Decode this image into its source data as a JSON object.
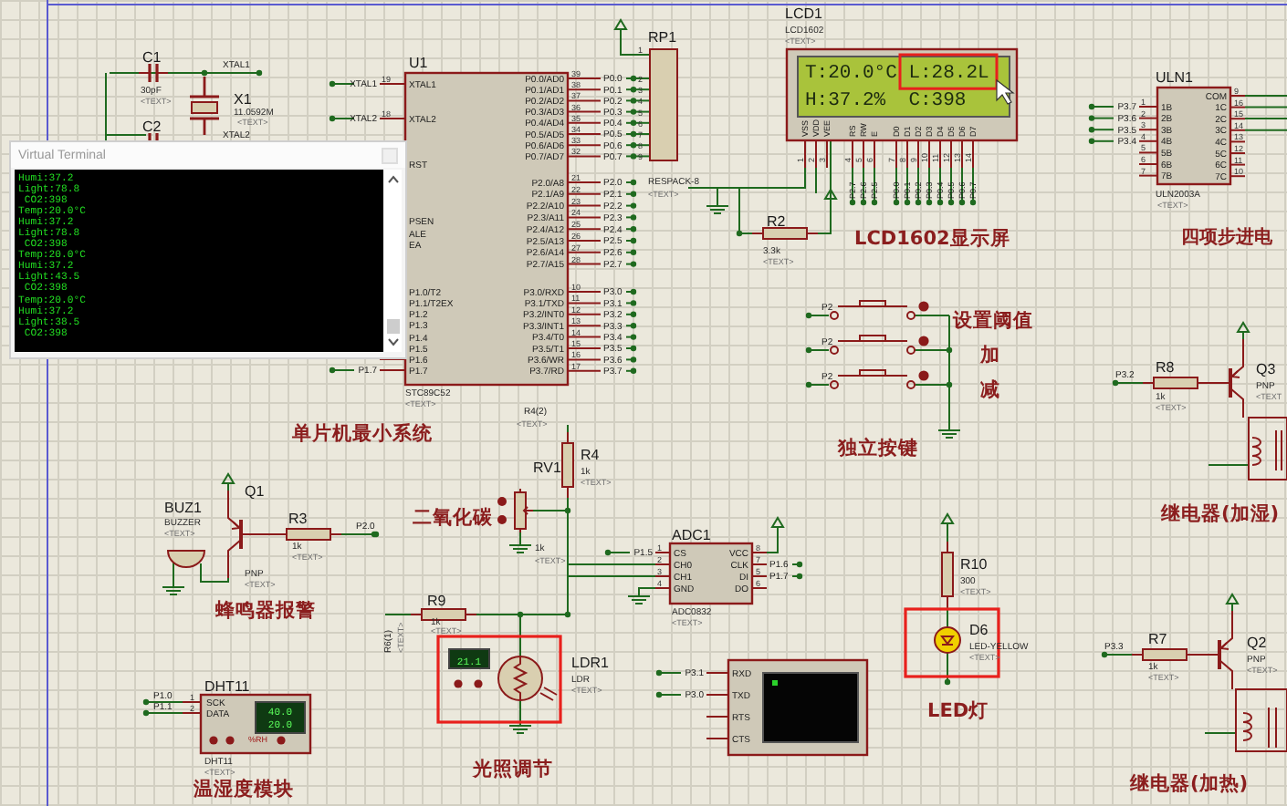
{
  "terminal_window": {
    "title": "Virtual Terminal",
    "lines": [
      "Humi:37.2",
      "Light:78.8",
      " CO2:398",
      "Temp:20.0°C",
      "Humi:37.2",
      "Light:78.8",
      " CO2:398",
      "Temp:20.0°C",
      "Humi:37.2",
      "Light:43.5",
      " CO2:398",
      "Temp:20.0°C",
      "Humi:37.2",
      "Light:38.5",
      " CO2:398"
    ]
  },
  "section_titles": [
    "单片机最小系统",
    "LCD1602显示屏",
    "四项步进电",
    "设置阈值",
    "加",
    "减",
    "独立按键",
    "二氧化碳",
    "蜂鸣器报警",
    "继电器(加湿)",
    "LED灯",
    "光照调节",
    "温湿度模块",
    "继电器(加热)"
  ],
  "components": [
    {
      "kind": "capacitor",
      "ref": "C1",
      "value": "30pF",
      "tag": "<TEXT>"
    },
    {
      "kind": "capacitor",
      "ref": "C2"
    },
    {
      "kind": "crystal",
      "ref": "X1",
      "value": "11.0592M",
      "tag": "<TEXT>"
    },
    {
      "kind": "respack",
      "ref": "RP1",
      "value": "RESPACK-8",
      "tag": "<TEXT>",
      "pins": [
        "1",
        "2",
        "3",
        "4",
        "5",
        "6",
        "7",
        "8",
        "9"
      ]
    },
    {
      "kind": "resistor",
      "ref": "R2",
      "value": "3.3k",
      "tag": "<TEXT>"
    },
    {
      "kind": "resistor",
      "ref": "R8",
      "value": "1k",
      "tag": "<TEXT>"
    },
    {
      "kind": "transistor",
      "ref": "Q3",
      "value": "PNP",
      "tag": "<TEXT"
    },
    {
      "kind": "resistor",
      "ref": "R4",
      "value": "1k",
      "tag": "<TEXT>"
    },
    {
      "kind": "potentiometer",
      "ref": "RV1",
      "value": "1k",
      "tag": "<TEXT>"
    },
    {
      "kind": "buzzer",
      "ref": "BUZ1",
      "value": "BUZZER",
      "tag": "<TEXT>"
    },
    {
      "kind": "transistor",
      "ref": "Q1",
      "value": "PNP",
      "tag": "<TEXT>"
    },
    {
      "kind": "resistor",
      "ref": "R3",
      "value": "1k",
      "tag": "<TEXT>"
    },
    {
      "kind": "resistor",
      "ref": "R9",
      "value": "1k",
      "tag": "<TEXT>"
    },
    {
      "kind": "ldr",
      "ref": "LDR1",
      "value": "LDR",
      "tag": "<TEXT>"
    },
    {
      "kind": "resistor",
      "ref": "R10",
      "value": "300",
      "tag": "<TEXT>"
    },
    {
      "kind": "led",
      "ref": "D6",
      "value": "LED-YELLOW",
      "tag": "<TEXT>"
    },
    {
      "kind": "resistor",
      "ref": "R7",
      "value": "1k",
      "tag": "<TEXT>"
    },
    {
      "kind": "transistor",
      "ref": "Q2",
      "value": "PNP",
      "tag": "<TEXT>"
    }
  ],
  "net_labels": [
    {
      "text": "XTAL1"
    },
    {
      "text": "XTAL2"
    },
    {
      "text": "R4(2)",
      "tag": "<TEXT>"
    },
    {
      "text": "R6(1)",
      "tag": "<TEXT>"
    },
    {
      "text": "P2.0"
    },
    {
      "text": "P3.2"
    },
    {
      "text": "P3.3"
    },
    {
      "text": "P2"
    },
    {
      "text": "P2"
    },
    {
      "text": "P2"
    }
  ],
  "chips": [
    {
      "kind": "ic",
      "ref": "U1",
      "part": "STC89C52",
      "tag": "<TEXT>",
      "left": [
        {
          "name": "XTAL1",
          "num": "19",
          "net": "XTAL1"
        },
        {
          "name": "XTAL2",
          "num": "18",
          "net": "XTAL2"
        },
        {
          "name": "RST"
        },
        {
          "name": "PSEN"
        },
        {
          "name": "ALE"
        },
        {
          "name": "EA"
        },
        {
          "name": "P1.0/T2"
        },
        {
          "name": "P1.1/T2EX"
        },
        {
          "name": "P1.2"
        },
        {
          "name": "P1.3"
        },
        {
          "name": "P1.4"
        },
        {
          "name": "P1.5"
        },
        {
          "name": "P1.6"
        },
        {
          "name": "P1.7",
          "net": "P1.7"
        }
      ],
      "right": [
        {
          "name": "P0.0/AD0",
          "num": "39",
          "net": "P0.0"
        },
        {
          "name": "P0.1/AD1",
          "num": "38",
          "net": "P0.1"
        },
        {
          "name": "P0.2/AD2",
          "num": "37",
          "net": "P0.2"
        },
        {
          "name": "P0.3/AD3",
          "num": "36",
          "net": "P0.3"
        },
        {
          "name": "P0.4/AD4",
          "num": "35",
          "net": "P0.4"
        },
        {
          "name": "P0.5/AD5",
          "num": "34",
          "net": "P0.5"
        },
        {
          "name": "P0.6/AD6",
          "num": "33",
          "net": "P0.6"
        },
        {
          "name": "P0.7/AD7",
          "num": "32",
          "net": "P0.7"
        },
        {
          "name": "P2.0/A8",
          "num": "21",
          "net": "P2.0"
        },
        {
          "name": "P2.1/A9",
          "num": "22",
          "net": "P2.1"
        },
        {
          "name": "P2.2/A10",
          "num": "23",
          "net": "P2.2"
        },
        {
          "name": "P2.3/A11",
          "num": "24",
          "net": "P2.3"
        },
        {
          "name": "P2.4/A12",
          "num": "25",
          "net": "P2.4"
        },
        {
          "name": "P2.5/A13",
          "num": "26",
          "net": "P2.5"
        },
        {
          "name": "P2.6/A14",
          "num": "27",
          "net": "P2.6"
        },
        {
          "name": "P2.7/A15",
          "num": "28",
          "net": "P2.7"
        },
        {
          "name": "P3.0/RXD",
          "num": "10",
          "net": "P3.0"
        },
        {
          "name": "P3.1/TXD",
          "num": "11",
          "net": "P3.1"
        },
        {
          "name": "P3.2/INT0",
          "num": "12",
          "net": "P3.2"
        },
        {
          "name": "P3.3/INT1",
          "num": "13",
          "net": "P3.3"
        },
        {
          "name": "P3.4/T0",
          "num": "14",
          "net": "P3.4"
        },
        {
          "name": "P3.5/T1",
          "num": "15",
          "net": "P3.5"
        },
        {
          "name": "P3.6/WR",
          "num": "16",
          "net": "P3.6"
        },
        {
          "name": "P3.7/RD",
          "num": "17",
          "net": "P3.7"
        }
      ]
    },
    {
      "kind": "ic",
      "ref": "ULN1",
      "part": "ULN2003A",
      "tag": "<TEXT>",
      "left": [
        {
          "name": "1B",
          "num": "1",
          "net": "P3.7"
        },
        {
          "name": "2B",
          "num": "2",
          "net": "P3.6"
        },
        {
          "name": "3B",
          "num": "3",
          "net": "P3.5"
        },
        {
          "name": "4B",
          "num": "4",
          "net": "P3.4"
        },
        {
          "name": "5B",
          "num": "5"
        },
        {
          "name": "6B",
          "num": "6"
        },
        {
          "name": "7B",
          "num": "7"
        }
      ],
      "right": [
        {
          "name": "COM",
          "num": "9"
        },
        {
          "name": "1C",
          "num": "16"
        },
        {
          "name": "2C",
          "num": "15"
        },
        {
          "name": "3C",
          "num": "14"
        },
        {
          "name": "4C",
          "num": "13"
        },
        {
          "name": "5C",
          "num": "12"
        },
        {
          "name": "6C",
          "num": "11"
        },
        {
          "name": "7C",
          "num": "10"
        }
      ]
    },
    {
      "kind": "ic",
      "ref": "ADC1",
      "part": "ADC0832",
      "tag": "<TEXT>",
      "left": [
        {
          "name": "CS",
          "num": "1",
          "net": "P1.5"
        },
        {
          "name": "CH0",
          "num": "2"
        },
        {
          "name": "CH1",
          "num": "3"
        },
        {
          "name": "GND",
          "num": "4"
        }
      ],
      "right": [
        {
          "name": "VCC",
          "num": "8"
        },
        {
          "name": "CLK",
          "num": "7",
          "net": "P1.6"
        },
        {
          "name": "DI",
          "num": "5",
          "net": "P1.7"
        },
        {
          "name": "DO",
          "num": "6"
        }
      ]
    },
    {
      "kind": "terminal",
      "left": [
        {
          "name": "RXD",
          "net": "P3.1"
        },
        {
          "name": "TXD",
          "net": "P3.0"
        },
        {
          "name": "RTS"
        },
        {
          "name": "CTS"
        }
      ]
    }
  ],
  "lcd": {
    "ref": "LCD1",
    "part": "LCD1602",
    "tag": "<TEXT>",
    "lines": [
      [
        "T:20.0°C",
        "L:28.2L"
      ],
      [
        "H:37.2%",
        "C:398"
      ]
    ],
    "pins": [
      {
        "name": "VSS",
        "num": "1"
      },
      {
        "name": "VDD",
        "num": "2"
      },
      {
        "name": "VEE",
        "num": "3"
      },
      {
        "name": "RS",
        "num": "4",
        "net": "P2.7"
      },
      {
        "name": "RW",
        "num": "5",
        "net": "P2.6"
      },
      {
        "name": "E",
        "num": "6",
        "net": "P2.5"
      },
      {
        "name": "D0",
        "num": "7",
        "net": "P0.0"
      },
      {
        "name": "D1",
        "num": "8",
        "net": "P0.1"
      },
      {
        "name": "D2",
        "num": "9",
        "net": "P0.2"
      },
      {
        "name": "D3",
        "num": "10",
        "net": "P0.3"
      },
      {
        "name": "D4",
        "num": "11",
        "net": "P0.4"
      },
      {
        "name": "D5",
        "num": "12",
        "net": "P0.5"
      },
      {
        "name": "D6",
        "num": "13",
        "net": "P0.6"
      },
      {
        "name": "D7",
        "num": "14",
        "net": "P0.7"
      }
    ]
  },
  "dht": {
    "ref": "DHT11",
    "part": "DHT11",
    "tag": "<TEXT>",
    "pins": [
      {
        "name": "SCK",
        "num": "1",
        "net": "P1.0"
      },
      {
        "name": "DATA",
        "num": "2",
        "net": "P1.1"
      }
    ],
    "readings": [
      "40.0",
      "20.0"
    ],
    "unit": "%RH"
  },
  "light_meter": {
    "reading": "21.1"
  }
}
